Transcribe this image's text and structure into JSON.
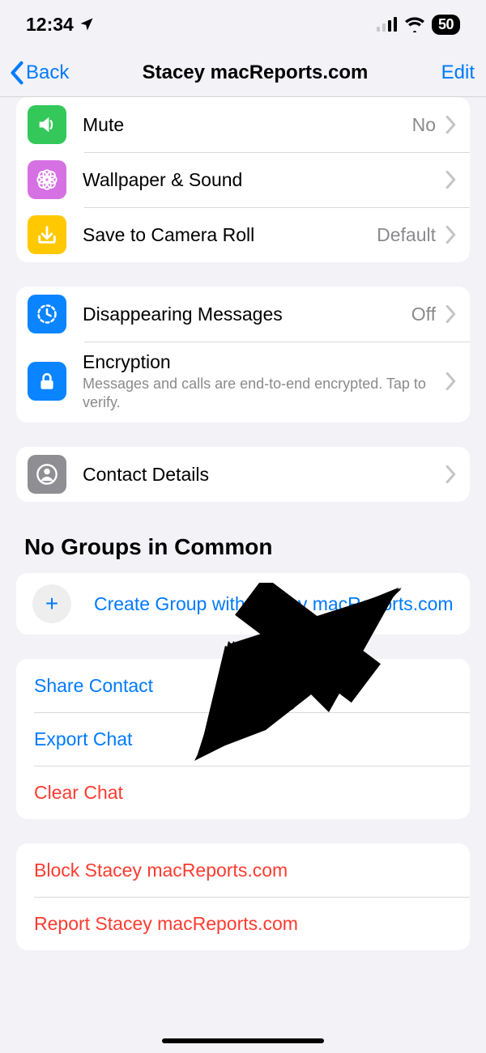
{
  "status": {
    "time": "12:34",
    "battery": "50"
  },
  "nav": {
    "back": "Back",
    "title": "Stacey macReports.com",
    "edit": "Edit"
  },
  "settings1": {
    "mute": {
      "label": "Mute",
      "value": "No"
    },
    "wallpaper": {
      "label": "Wallpaper & Sound"
    },
    "camera_roll": {
      "label": "Save to Camera Roll",
      "value": "Default"
    }
  },
  "settings2": {
    "disappearing": {
      "label": "Disappearing Messages",
      "value": "Off"
    },
    "encryption": {
      "label": "Encryption",
      "sub": "Messages and calls are end-to-end encrypted. Tap to verify."
    }
  },
  "settings3": {
    "contact_details": {
      "label": "Contact Details"
    }
  },
  "groups_section": {
    "header": "No Groups in Common",
    "create_label": "Create Group with Stacey macReports.com"
  },
  "actions": {
    "share": "Share Contact",
    "export": "Export Chat",
    "clear": "Clear Chat",
    "block": "Block Stacey macReports.com",
    "report": "Report Stacey macReports.com"
  }
}
